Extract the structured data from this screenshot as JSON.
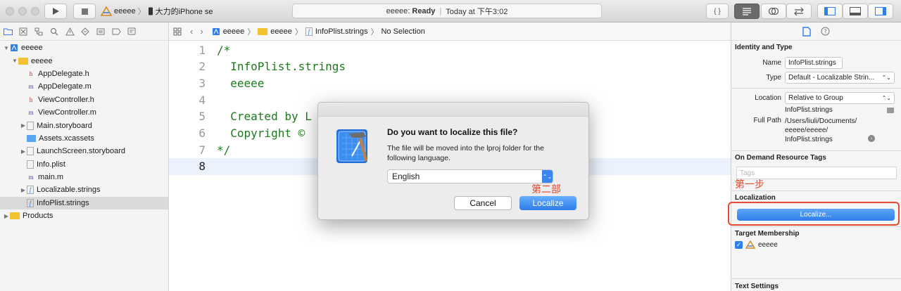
{
  "toolbar": {
    "run_icon": "play-icon",
    "stop_icon": "stop-icon",
    "scheme_project": "eeeee",
    "scheme_device": "大力的iPhone se",
    "activity_project": "eeeee:",
    "activity_status": "Ready",
    "activity_time": "Today at 下午3:02",
    "braces": "{ }"
  },
  "navigator": {
    "items": [
      {
        "label": "eeeee",
        "indent": 0,
        "disclosure": "▼",
        "icon": "project",
        "selected": false
      },
      {
        "label": "eeeee",
        "indent": 1,
        "disclosure": "▼",
        "icon": "folder",
        "selected": false
      },
      {
        "label": "AppDelegate.h",
        "indent": 2,
        "disclosure": "",
        "icon": "h",
        "selected": false
      },
      {
        "label": "AppDelegate.m",
        "indent": 2,
        "disclosure": "",
        "icon": "m",
        "selected": false
      },
      {
        "label": "ViewController.h",
        "indent": 2,
        "disclosure": "",
        "icon": "h",
        "selected": false
      },
      {
        "label": "ViewController.m",
        "indent": 2,
        "disclosure": "",
        "icon": "m",
        "selected": false
      },
      {
        "label": "Main.storyboard",
        "indent": 2,
        "disclosure": "▶",
        "icon": "storyboard",
        "selected": false
      },
      {
        "label": "Assets.xcassets",
        "indent": 2,
        "disclosure": "",
        "icon": "assets",
        "selected": false
      },
      {
        "label": "LaunchScreen.storyboard",
        "indent": 2,
        "disclosure": "▶",
        "icon": "storyboard",
        "selected": false
      },
      {
        "label": "Info.plist",
        "indent": 2,
        "disclosure": "",
        "icon": "plist",
        "selected": false
      },
      {
        "label": "main.m",
        "indent": 2,
        "disclosure": "",
        "icon": "m",
        "selected": false
      },
      {
        "label": "Localizable.strings",
        "indent": 2,
        "disclosure": "▶",
        "icon": "strings",
        "selected": false
      },
      {
        "label": "InfoPlist.strings",
        "indent": 2,
        "disclosure": "",
        "icon": "strings",
        "selected": true
      },
      {
        "label": "Products",
        "indent": 0,
        "disclosure": "▶",
        "icon": "folder",
        "selected": false
      }
    ]
  },
  "jumpbar": {
    "crumb1": "eeeee",
    "crumb2": "eeeee",
    "crumb3": "InfoPlist.strings",
    "crumb4": "No Selection"
  },
  "editor": {
    "lines": [
      {
        "num": "1",
        "code": "/*"
      },
      {
        "num": "2",
        "code": "  InfoPlist.strings"
      },
      {
        "num": "3",
        "code": "  eeeee"
      },
      {
        "num": "4",
        "code": ""
      },
      {
        "num": "5",
        "code": "  Created by L"
      },
      {
        "num": "6",
        "code": "  Copyright ©"
      },
      {
        "num": "7",
        "code": "*/"
      },
      {
        "num": "8",
        "code": ""
      }
    ],
    "current_line": 8
  },
  "dialog": {
    "question": "Do you want to localize this file?",
    "description": "The file will be moved into the lproj folder for the following language.",
    "language": "English",
    "cancel_label": "Cancel",
    "ok_label": "Localize",
    "annotation": "第二部"
  },
  "inspector": {
    "identity_title": "Identity and Type",
    "name_label": "Name",
    "name_value": "InfoPlist.strings",
    "type_label": "Type",
    "type_value": "Default - Localizable Strin...",
    "location_label": "Location",
    "location_value": "Relative to Group",
    "location_file": "InfoPlist.strings",
    "fullpath_label": "Full Path",
    "fullpath_line1": "/Users/liuli/Documents/",
    "fullpath_line2": "eeeee/eeeee/",
    "fullpath_line3": "InfoPlist.strings",
    "odr_title": "On Demand Resource Tags",
    "tags_placeholder": "Tags",
    "annotation": "第一步",
    "localization_title": "Localization",
    "localize_button": "Localize...",
    "target_title": "Target Membership",
    "target_name": "eeeee",
    "text_settings_title": "Text Settings"
  },
  "colors": {
    "code_green": "#1d7a1d",
    "accent_blue": "#2f7ee9",
    "annotation_red": "#e84a2e"
  }
}
